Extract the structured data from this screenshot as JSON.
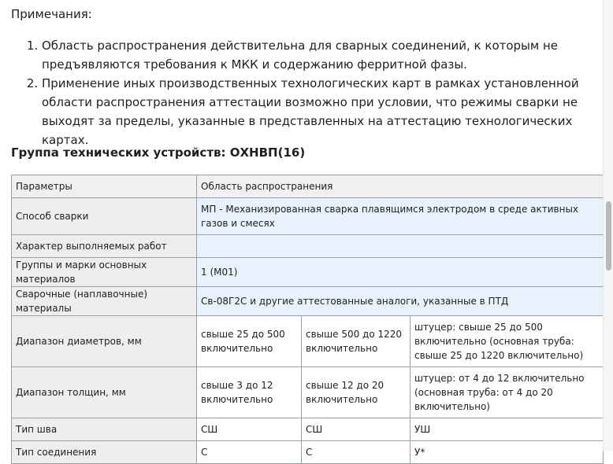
{
  "notes": {
    "title": "Примечания:",
    "items": [
      "Область распространения действительна для сварных соединений, к которым не предъявляются требования к МКК и содержанию ферритной фазы.",
      "Применение иных производственных технологических карт в рамках установленной области распространения аттестации возможно при условии, что режимы сварки не выходят за пределы, указанные в представленных на аттестацию технологических картах."
    ]
  },
  "group": {
    "title": "Группа технических устройств: ОХНВП(16)"
  },
  "table": {
    "header": [
      "Параметры",
      "Область распространения"
    ],
    "rows": {
      "method": {
        "label": "Способ сварки",
        "value": "МП - Механизированная сварка плавящимся электродом в среде активных газов и смесях"
      },
      "work": {
        "label": "Характер выполняемых работ",
        "value": ""
      },
      "groups": {
        "label": "Группы и марки основных материалов",
        "value": "1 (М01)"
      },
      "consumables": {
        "label": "Сварочные (наплавочные) материалы",
        "value": "Св-08Г2С и другие аттестованные аналоги, указанные в ПТД"
      },
      "diameters": {
        "label": "Диапазон диаметров, мм",
        "values": [
          "свыше 25 до 500 включительно",
          "свыше 500 до 1220 включительно",
          "штуцер: свыше 25 до 500 включительно (основная труба: свыше 25 до 1220 включительно)"
        ]
      },
      "thickness": {
        "label": "Диапазон толщин, мм",
        "values": [
          "свыше 3 до 12 включительно",
          "свыше 12 до 20 включительно",
          "штуцер: от 4 до 12 включительно (основная труба: от 4 до 20 включительно)"
        ]
      },
      "seam": {
        "label": "Тип шва",
        "values": [
          "СШ",
          "СШ",
          "УШ"
        ]
      },
      "joint": {
        "label": "Тип соединения",
        "values": [
          "С",
          "С",
          "У*"
        ]
      }
    }
  }
}
